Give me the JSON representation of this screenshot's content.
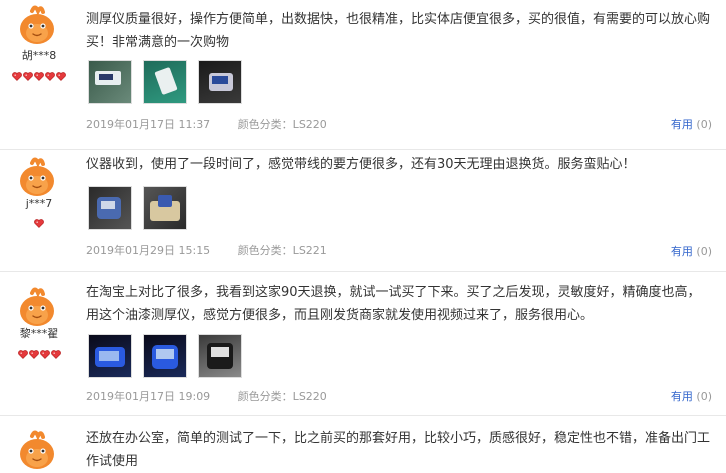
{
  "reviews": [
    {
      "username": "胡***8",
      "hearts": 5,
      "text": "测厚仪质量很好，操作方便简单，出数据快，也很精准，比实体店便宜很多，买的很值，有需要的可以放心购买！非常满意的一次购物",
      "date": "2019年01月17日 11:37",
      "color_label": "颜色分类：LS220",
      "useful_label": "有用",
      "useful_count": "(0)"
    },
    {
      "username": "j***7",
      "hearts": 1,
      "text": "仪器收到，使用了一段时间了，感觉带线的要方便很多，还有30天无理由退换货。服务蛮贴心！",
      "date": "2019年01月29日 15:15",
      "color_label": "颜色分类：LS221",
      "useful_label": "有用",
      "useful_count": "(0)"
    },
    {
      "username": "黎***翟",
      "hearts": 4,
      "text": "在淘宝上对比了很多，我看到这家90天退换，就试一试买了下来。买了之后发现，灵敏度好，精确度也高，用这个油漆测厚仪，感觉方便很多，而且刚发货商家就发使用视频过来了，服务很用心。",
      "date": "2019年01月17日 19:09",
      "color_label": "颜色分类：LS220",
      "useful_label": "有用",
      "useful_count": "(0)"
    },
    {
      "username": "",
      "hearts": 0,
      "text": "还放在办公室，简单的测试了一下，比之前买的那套好用，比较小巧，质感很好，稳定性也不错，准备出门工作试使用",
      "date": "",
      "color_label": "",
      "useful_label": "",
      "useful_count": ""
    }
  ],
  "colors": {
    "accent_link": "#3366cc",
    "meta_gray": "#999999",
    "heart_red": "#e4393c",
    "avatar_orange": "#f2892e"
  }
}
